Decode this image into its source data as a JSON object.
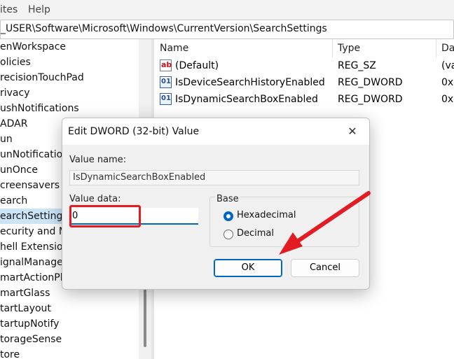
{
  "menu": {
    "items": [
      "ites",
      "Help"
    ]
  },
  "address": "_USER\\Software\\Microsoft\\Windows\\CurrentVersion\\SearchSettings",
  "tree": {
    "items": [
      "enWorkspace",
      "olicies",
      "recisionTouchPad",
      "rivacy",
      "ushNotifications",
      "ADAR",
      "un",
      "unNotification",
      "unOnce",
      "creensavers",
      "earch",
      "earchSettings",
      "ecurity and M",
      "hell Extension",
      "ignalManager",
      "martActionPla",
      "martGlass",
      "tartLayout",
      "tartupNotify",
      "torageSense",
      "tore"
    ],
    "selected_index": 11
  },
  "list": {
    "columns": {
      "name": "Name",
      "type": "Type",
      "data": "Da"
    },
    "rows": [
      {
        "icon": "string-value-icon",
        "name": "(Default)",
        "type": "REG_SZ",
        "data": "(va"
      },
      {
        "icon": "dword-value-icon",
        "name": "IsDeviceSearchHistoryEnabled",
        "type": "REG_DWORD",
        "data": "0x"
      },
      {
        "icon": "dword-value-icon",
        "name": "IsDynamicSearchBoxEnabled",
        "type": "REG_DWORD",
        "data": "0x"
      }
    ]
  },
  "dialog": {
    "title": "Edit DWORD (32-bit) Value",
    "close_glyph": "✕",
    "value_name_label": "Value name:",
    "value_name": "IsDynamicSearchBoxEnabled",
    "value_data_label": "Value data:",
    "value_data": "0",
    "base_label": "Base",
    "base_options": [
      "Hexadecimal",
      "Decimal"
    ],
    "base_selected": "Hexadecimal",
    "ok_label": "OK",
    "cancel_label": "Cancel"
  },
  "annotation": {
    "arrow_color": "#e31b23",
    "highlight_color": "#e31b23"
  }
}
